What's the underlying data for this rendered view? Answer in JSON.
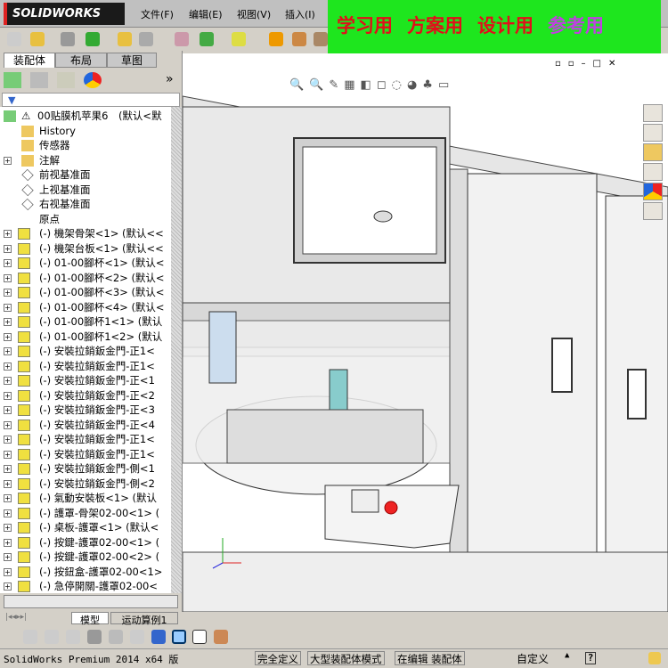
{
  "app": {
    "logo": "SOLIDWORKS"
  },
  "menu": [
    "文件(F)",
    "编辑(E)",
    "视图(V)",
    "插入(I)"
  ],
  "banner": {
    "items": [
      "学习用",
      "方案用",
      "设计用",
      "参考用"
    ],
    "colors": [
      "#e0101a",
      "#e0101a",
      "#e0101a",
      "#c040e0"
    ],
    "background": "#1ee61e"
  },
  "panel": {
    "tabs": [
      "装配体",
      "布局",
      "草图"
    ],
    "expand": "»"
  },
  "tree": {
    "root": "00贴膜机苹果6　(默认<默",
    "features": [
      {
        "label": "History",
        "icon": "history-icon"
      },
      {
        "label": "传感器",
        "icon": "sensor-icon"
      },
      {
        "label": "注解",
        "icon": "annotation-icon",
        "expand": true
      },
      {
        "label": "前视基准面",
        "icon": "plane-icon"
      },
      {
        "label": "上视基准面",
        "icon": "plane-icon"
      },
      {
        "label": "右视基准面",
        "icon": "plane-icon"
      },
      {
        "label": "原点",
        "icon": "origin-icon"
      }
    ],
    "components": [
      "(-) 機架骨架<1> (默认<<",
      "(-) 機架台板<1> (默认<<",
      "(-) 01-00腳杯<1> (默认<",
      "(-) 01-00腳杯<2> (默认<",
      "(-) 01-00腳杯<3> (默认<",
      "(-) 01-00腳杯<4> (默认<",
      "(-) 01-00腳杯1<1> (默认",
      "(-) 01-00腳杯1<2> (默认",
      "(-) 安裝拉銷鈑金門-正1<",
      "(-) 安裝拉銷鈑金門-正1<",
      "(-) 安裝拉銷鈑金門-正<1",
      "(-) 安裝拉銷鈑金門-正<2",
      "(-) 安裝拉銷鈑金門-正<3",
      "(-) 安裝拉銷鈑金門-正<4",
      "(-) 安裝拉銷鈑金門-正1<",
      "(-) 安裝拉銷鈑金門-正1<",
      "(-) 安裝拉銷鈑金門-側<1",
      "(-) 安裝拉銷鈑金門-側<2",
      "(-) 氣動安裝板<1> (默认",
      "(-) 護罩-骨架02-00<1> (",
      "(-) 桌板-護罩<1> (默认<",
      "(-) 按鍵-護罩02-00<1> (",
      "(-) 按鍵-護罩02-00<2> (",
      "(-) 按鈕盒-護罩02-00<1>",
      "(-) 急停開關-護罩02-00<"
    ]
  },
  "bottom_tabs": [
    "模型",
    "运动算例1"
  ],
  "status": {
    "product": "SolidWorks Premium 2014 x64 版",
    "items": [
      "完全定义",
      "大型装配体模式",
      "在编辑 装配体"
    ],
    "custom": "自定义",
    "help": "?"
  }
}
